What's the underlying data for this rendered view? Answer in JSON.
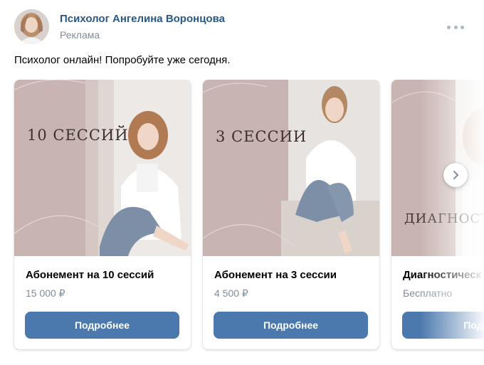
{
  "post": {
    "author": "Психолог Ангелина Воронцова",
    "label": "Реклама",
    "text": "Психолог онлайн! Попробуйте уже сегодня."
  },
  "cards": [
    {
      "promo_text": "10 СЕССИЙ",
      "title": "Абонемент на 10 сессий",
      "price": "15 000 ₽",
      "button": "Подробнее"
    },
    {
      "promo_text": "3 СЕССИИ",
      "title": "Абонемент на 3 сессии",
      "price": "4 500 ₽",
      "button": "Подробнее"
    },
    {
      "promo_text": "ДИАГНОСТ",
      "title": "Диагностическ",
      "price": "Бесплатно",
      "button": "Подро"
    }
  ],
  "colors": {
    "link": "#2a5885",
    "secondary_text": "#818c99",
    "button": "#4b78ad",
    "promo_background": "#c8b4b0"
  },
  "icons": {
    "more": "more-horizontal-icon",
    "next": "chevron-right-icon"
  }
}
